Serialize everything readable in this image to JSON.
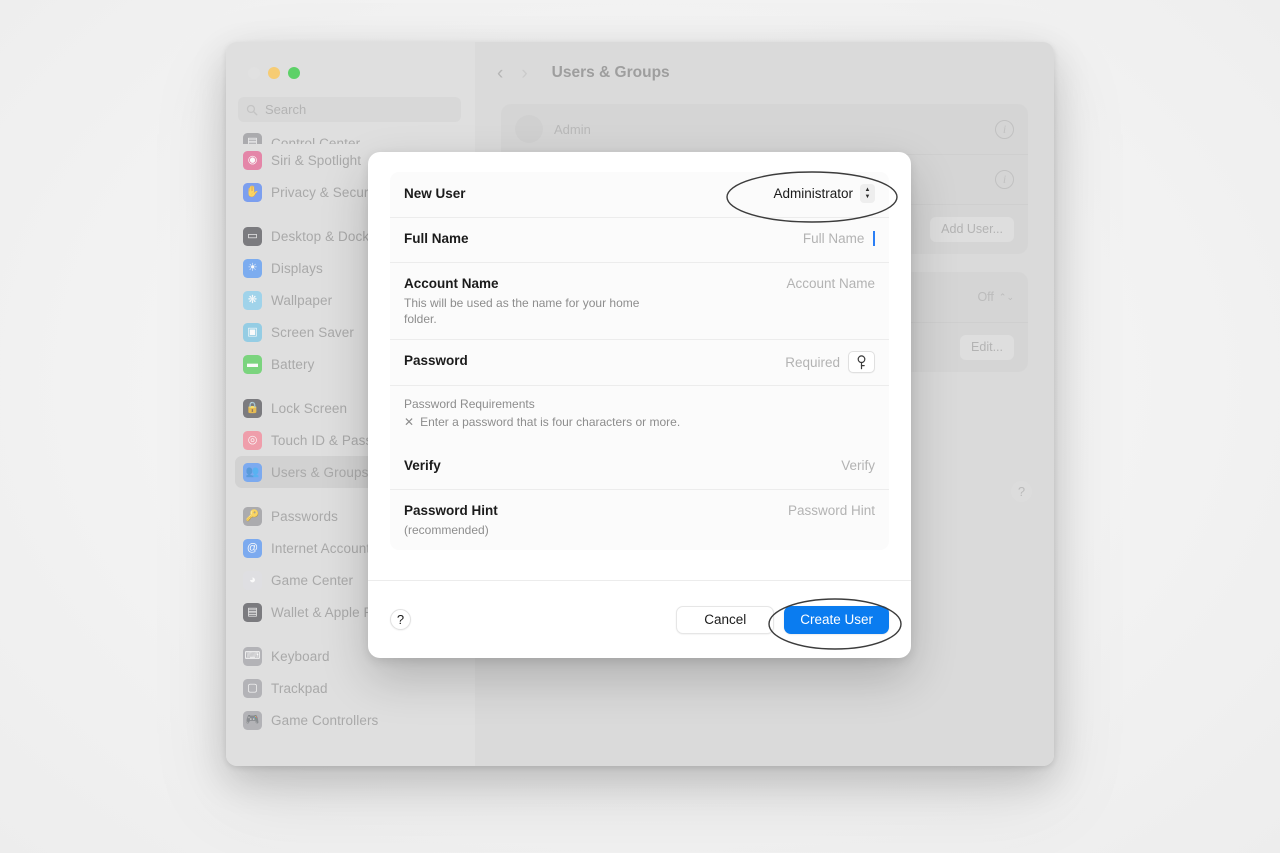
{
  "window": {
    "title": "Users & Groups",
    "traffic_lights": [
      "close",
      "minimize",
      "zoom"
    ],
    "nav_back": "‹",
    "nav_forward": "›"
  },
  "search": {
    "placeholder": "Search",
    "icon": "search-icon"
  },
  "sidebar": {
    "groups": [
      {
        "items": [
          {
            "label": "Control Center",
            "icon": "control-center-icon",
            "color": "#8e8e93",
            "glyph": "▤",
            "clipped": true
          },
          {
            "label": "Siri & Spotlight",
            "icon": "siri-icon",
            "color": "#e05a8a",
            "glyph": "◉"
          },
          {
            "label": "Privacy & Security",
            "icon": "privacy-icon",
            "color": "#4b7df0",
            "glyph": "✋"
          }
        ]
      },
      {
        "items": [
          {
            "label": "Desktop & Dock",
            "icon": "desktop-dock-icon",
            "color": "#4a4a4f",
            "glyph": "▭"
          },
          {
            "label": "Displays",
            "icon": "displays-icon",
            "color": "#4b90f0",
            "glyph": "☀"
          },
          {
            "label": "Wallpaper",
            "icon": "wallpaper-icon",
            "color": "#7fc7e8",
            "glyph": "❋"
          },
          {
            "label": "Screen Saver",
            "icon": "screen-saver-icon",
            "color": "#6fbfe0",
            "glyph": "▣"
          },
          {
            "label": "Battery",
            "icon": "battery-icon",
            "color": "#49c94e",
            "glyph": "▬"
          }
        ]
      },
      {
        "items": [
          {
            "label": "Lock Screen",
            "icon": "lock-screen-icon",
            "color": "#4a4a4f",
            "glyph": "🔒"
          },
          {
            "label": "Touch ID & Password",
            "icon": "touch-id-icon",
            "color": "#f07b8e",
            "glyph": "◎"
          },
          {
            "label": "Users & Groups",
            "icon": "users-groups-icon",
            "color": "#4b8df0",
            "glyph": "👥",
            "selected": true
          }
        ]
      },
      {
        "items": [
          {
            "label": "Passwords",
            "icon": "passwords-icon",
            "color": "#8e8e93",
            "glyph": "🔑"
          },
          {
            "label": "Internet Accounts",
            "icon": "internet-accounts-icon",
            "color": "#4b8df0",
            "glyph": "@"
          },
          {
            "label": "Game Center",
            "icon": "game-center-icon",
            "color": "#d8d8dd",
            "glyph": "◕"
          },
          {
            "label": "Wallet & Apple Pay",
            "icon": "wallet-icon",
            "color": "#4a4a4f",
            "glyph": "▤"
          }
        ]
      },
      {
        "items": [
          {
            "label": "Keyboard",
            "icon": "keyboard-icon",
            "color": "#9a9a9f",
            "glyph": "⌨"
          },
          {
            "label": "Trackpad",
            "icon": "trackpad-icon",
            "color": "#9a9a9f",
            "glyph": "▢"
          },
          {
            "label": "Game Controllers",
            "icon": "game-controllers-icon",
            "color": "#9a9a9f",
            "glyph": "🎮"
          }
        ]
      }
    ]
  },
  "detail": {
    "user_row": {
      "name": "Admin",
      "info_label": "i"
    },
    "second_row_info_label": "i",
    "add_user_button": "Add User...",
    "guest_popup_value": "Off",
    "edit_button": "Edit...",
    "help_button": "?"
  },
  "sheet": {
    "fields": [
      {
        "id": "new-user",
        "label": "New User",
        "sub": null,
        "value": "Administrator",
        "control": "popup"
      },
      {
        "id": "full-name",
        "label": "Full Name",
        "sub": null,
        "placeholder": "Full Name",
        "control": "text-focused"
      },
      {
        "id": "account-name",
        "label": "Account Name",
        "sub": "This will be used as the name for your home folder.",
        "placeholder": "Account Name",
        "control": "text"
      },
      {
        "id": "password",
        "label": "Password",
        "sub": null,
        "placeholder": "Required",
        "control": "password"
      }
    ],
    "requirements": {
      "title": "Password Requirements",
      "marker": "✕",
      "text": "Enter a password that is four characters or more."
    },
    "fields_after": [
      {
        "id": "verify",
        "label": "Verify",
        "sub": null,
        "placeholder": "Verify",
        "control": "text"
      },
      {
        "id": "password-hint",
        "label": "Password Hint",
        "sub": "(recommended)",
        "placeholder": "Password Hint",
        "control": "text"
      }
    ],
    "footer": {
      "help": "?",
      "cancel": "Cancel",
      "create": "Create User"
    }
  },
  "annotations": {
    "highlight_role_popup": true,
    "highlight_create_button": true,
    "stroke_color": "#3c3c3c"
  }
}
